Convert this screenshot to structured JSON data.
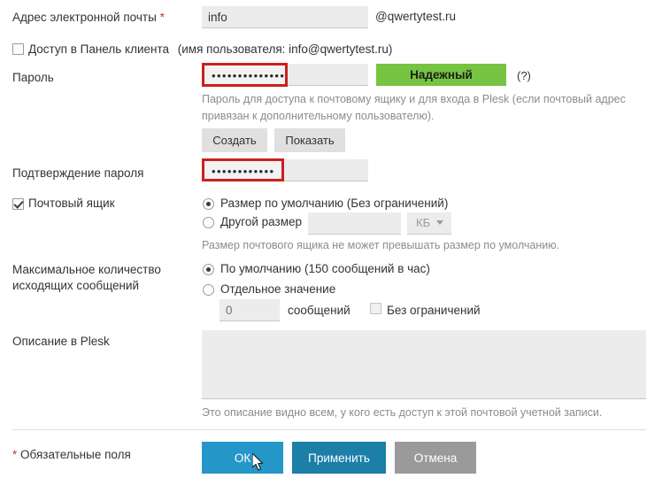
{
  "form": {
    "email": {
      "label": "Адрес электронной почты",
      "required_mark": "*",
      "value": "info",
      "placeholder": "",
      "domain_suffix": "@qwertytest.ru"
    },
    "panel_access": {
      "label": "Доступ в Панель клиента",
      "hint": "(имя пользователя: info@qwertytest.ru)",
      "checked": false
    },
    "password": {
      "label": "Пароль",
      "value": "••••••••••••••",
      "strength_label": "Надежный",
      "strength_color": "#76c442",
      "help_label": "(?)",
      "description": "Пароль для доступа к почтовому ящику и для входа в Plesk (если почтовый адрес привязан к дополнительному пользователю).",
      "generate_label": "Создать",
      "show_label": "Показать"
    },
    "password_confirm": {
      "label": "Подтверждение пароля",
      "value": "••••••••••••"
    },
    "mailbox": {
      "label": "Почтовый ящик",
      "checked": true,
      "options": [
        {
          "label": "Размер по умолчанию (Без ограничений)",
          "selected": true
        },
        {
          "label": "Другой размер",
          "selected": false
        }
      ],
      "size_value": "",
      "size_unit": "КБ",
      "note": "Размер почтового ящика не может превышать размер по умолчанию."
    },
    "outgoing": {
      "label_line1": "Максимальное количество",
      "label_line2": "исходящих сообщений",
      "options": [
        {
          "label": "По умолчанию (150 сообщений в час)",
          "selected": true
        },
        {
          "label": "Отдельное значение",
          "selected": false
        }
      ],
      "value_placeholder": "0",
      "value": "",
      "unit_label": "сообщений",
      "unlimited_label": "Без ограничений",
      "unlimited_checked": false
    },
    "description": {
      "label": "Описание в Plesk",
      "value": "",
      "note": "Это описание видно всем, у кого есть доступ к этой почтовой учетной записи."
    },
    "footer": {
      "required_note_star": "*",
      "required_note": "Обязательные поля",
      "ok_label": "ОК",
      "apply_label": "Применить",
      "cancel_label": "Отмена"
    }
  }
}
